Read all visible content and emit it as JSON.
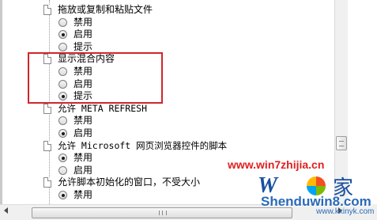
{
  "settings": [
    {
      "type": "group",
      "label": "拖放或复制和粘贴文件",
      "font": "cjk"
    },
    {
      "type": "option",
      "label": "禁用",
      "checked": false
    },
    {
      "type": "option",
      "label": "启用",
      "checked": true
    },
    {
      "type": "option",
      "label": "提示",
      "checked": false
    },
    {
      "type": "group",
      "label": "显示混合内容",
      "font": "cjk"
    },
    {
      "type": "option",
      "label": "禁用",
      "checked": false
    },
    {
      "type": "option",
      "label": "启用",
      "checked": false
    },
    {
      "type": "option",
      "label": "提示",
      "checked": true
    },
    {
      "type": "group",
      "label": "允许 META REFRESH",
      "font": "mono"
    },
    {
      "type": "option",
      "label": "禁用",
      "checked": false
    },
    {
      "type": "option",
      "label": "启用",
      "checked": true
    },
    {
      "type": "group",
      "label": "允许 Microsoft 网页浏览器控件的脚本",
      "font": "mono"
    },
    {
      "type": "option",
      "label": "禁用",
      "checked": true
    },
    {
      "type": "option",
      "label": "启用",
      "checked": false
    },
    {
      "type": "group",
      "label": "允许脚本初始化的窗口，不受大小",
      "font": "cjk"
    },
    {
      "type": "option",
      "label": "禁用",
      "checked": true
    }
  ],
  "watermark": {
    "url": "www.win7zhijia.cn",
    "site": "Shenduwin8.com",
    "site2": "www.kxinyk.com",
    "logo_text": "W",
    "home_glyph": "家"
  },
  "colors": {
    "highlight": "#d0262a",
    "watermark_red": "#e02020",
    "watermark_blue": "#1a4fa0"
  }
}
